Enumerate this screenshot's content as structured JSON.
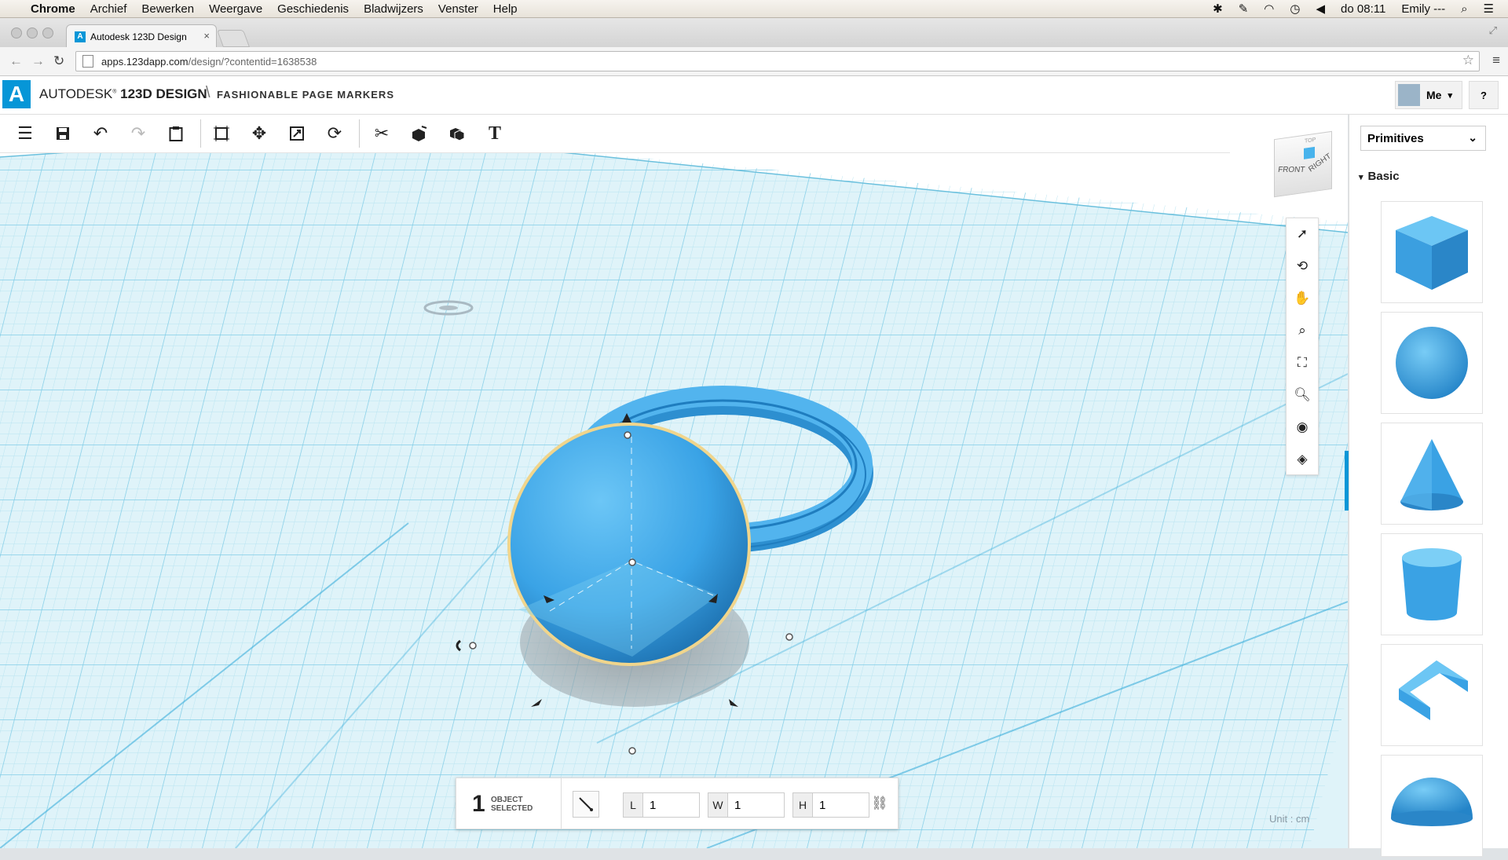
{
  "menubar": {
    "app": "Chrome",
    "items": [
      "Archief",
      "Bewerken",
      "Weergave",
      "Geschiedenis",
      "Bladwijzers",
      "Venster",
      "Help"
    ],
    "clock": "do 08:11",
    "user": "Emily ---"
  },
  "browser": {
    "tab_title": "Autodesk 123D Design",
    "url_host": "apps.123dapp.com",
    "url_path": "/design/?contentid=1638538"
  },
  "header": {
    "brand_prefix": "AUTODESK",
    "brand_product": "123D DESIGN",
    "separator": "\\",
    "project": "FASHIONABLE PAGE MARKERS",
    "user_button": "Me",
    "help_button": "?"
  },
  "toolbar": {
    "buttons": [
      "menu-icon",
      "save-icon",
      "undo-icon",
      "redo-icon",
      "paste-icon",
      "bounding-box-icon",
      "move-icon",
      "scale-icon",
      "rotate-icon",
      "construct-icon",
      "modify-icon",
      "combine-icon",
      "text-icon"
    ]
  },
  "viewcube": {
    "front": "FRONT",
    "right": "RIGHT",
    "top": "TOP"
  },
  "navbar": {
    "buttons": [
      "select-icon",
      "orbit-icon",
      "pan-icon",
      "zoom-icon",
      "fit-icon",
      "zoom-window-icon",
      "visibility-icon",
      "material-icon"
    ]
  },
  "selection": {
    "count": "1",
    "label_line1": "OBJECT",
    "label_line2": "SELECTED",
    "length_label": "L",
    "length_value": "1",
    "width_label": "W",
    "width_value": "1",
    "height_label": "H",
    "height_value": "1"
  },
  "unit": "Unit : cm",
  "panel": {
    "dropdown": "Primitives",
    "section": "Basic",
    "shapes": [
      "box-icon",
      "sphere-icon",
      "cone-icon",
      "cylinder-icon",
      "polygon-icon",
      "hemisphere-icon"
    ]
  },
  "colors": {
    "accent": "#0696d7",
    "shape_blue": "#3ea6e8",
    "grid": "#a8dced"
  }
}
